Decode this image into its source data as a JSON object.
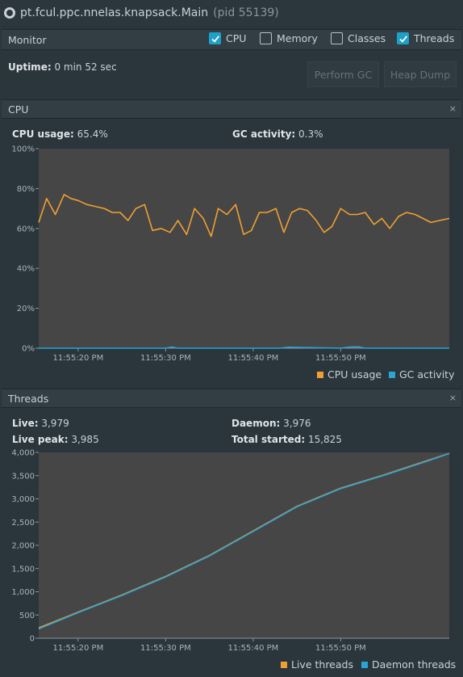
{
  "window": {
    "process_name": "pt.fcul.ppc.nnelas.knapsack.Main",
    "pid_label": "(pid 55139)"
  },
  "monitor": {
    "label": "Monitor",
    "checks": [
      {
        "label": "CPU",
        "checked": true
      },
      {
        "label": "Memory",
        "checked": false
      },
      {
        "label": "Classes",
        "checked": false
      },
      {
        "label": "Threads",
        "checked": true
      }
    ],
    "uptime_label": "Uptime:",
    "uptime_value": "0 min 52 sec",
    "perform_gc": "Perform GC",
    "heap_dump": "Heap Dump"
  },
  "cpu_section": {
    "title": "CPU",
    "usage_label": "CPU usage:",
    "usage_value": "65.4%",
    "gc_label": "GC activity:",
    "gc_value": "0.3%"
  },
  "threads_section": {
    "title": "Threads",
    "live_label": "Live:",
    "live_value": "3,979",
    "peak_label": "Live peak:",
    "peak_value": "3,985",
    "daemon_label": "Daemon:",
    "daemon_value": "3,976",
    "started_label": "Total started:",
    "started_value": "15,825"
  },
  "colors": {
    "orange": "#f0a030",
    "blue": "#2aa3d6"
  },
  "chart_data": [
    {
      "type": "line",
      "name": "cpu",
      "y_ticks": [
        "100%",
        "80%",
        "60%",
        "40%",
        "20%",
        "0%"
      ],
      "ylim": [
        0,
        100
      ],
      "x_ticks": [
        "11:55:20 PM",
        "11:55:30 PM",
        "11:55:40 PM",
        "11:55:50 PM"
      ],
      "x_tick_seconds": [
        20,
        30,
        40,
        50
      ],
      "xlim_seconds": [
        15.5,
        62.4
      ],
      "series": [
        {
          "name": "CPU usage",
          "color": "#f0a030",
          "x": [
            15.5,
            16.4,
            17.4,
            18.4,
            19.2,
            20.0,
            21.0,
            22.0,
            23.0,
            23.9,
            24.8,
            25.7,
            26.6,
            27.6,
            28.5,
            29.5,
            30.5,
            31.4,
            32.4,
            33.3,
            34.3,
            35.2,
            36.0,
            37.0,
            38.0,
            38.9,
            39.8,
            40.7,
            41.6,
            42.6,
            43.5,
            44.4,
            45.3,
            46.2,
            47.2,
            48.1,
            49.0,
            50.0,
            51.0,
            51.9,
            52.8,
            53.8,
            54.7,
            55.6,
            56.6,
            57.5,
            58.5,
            59.4,
            60.3,
            61.3,
            62.4
          ],
          "values": [
            63,
            75,
            67,
            77,
            75,
            74,
            72,
            71,
            70,
            68,
            68,
            64,
            70,
            72,
            59,
            60,
            58,
            64,
            57,
            70,
            65,
            56,
            70,
            67,
            72,
            57,
            59,
            68,
            68,
            70,
            58,
            68,
            70,
            69,
            64,
            58,
            61,
            70,
            67,
            67,
            68,
            62,
            65,
            60,
            66,
            68,
            67,
            65,
            63,
            64,
            65
          ]
        },
        {
          "name": "GC activity",
          "color": "#2aa3d6",
          "x": [
            15.5,
            30.0,
            30.7,
            31.4,
            40.0,
            43.0,
            44.0,
            50.0,
            51.0,
            52.0,
            52.8,
            62.4
          ],
          "values": [
            0,
            0,
            0.6,
            0,
            0,
            0,
            0.5,
            0,
            0.6,
            0.7,
            0,
            0
          ]
        }
      ],
      "legend": [
        "CPU usage",
        "GC activity"
      ]
    },
    {
      "type": "line",
      "name": "threads",
      "y_ticks": [
        "4,000",
        "3,500",
        "3,000",
        "2,500",
        "2,000",
        "1,500",
        "1,000",
        "500",
        "0"
      ],
      "ylim": [
        0,
        4000
      ],
      "x_ticks": [
        "11:55:20 PM",
        "11:55:30 PM",
        "11:55:40 PM",
        "11:55:50 PM"
      ],
      "x_tick_seconds": [
        20,
        30,
        40,
        50
      ],
      "xlim_seconds": [
        15.5,
        62.4
      ],
      "series": [
        {
          "name": "Live threads",
          "color": "#f0a030",
          "x": [
            15.5,
            20,
            25,
            30,
            35,
            40,
            45,
            50,
            55,
            60,
            62.4
          ],
          "values": [
            220,
            560,
            930,
            1330,
            1780,
            2310,
            2840,
            3230,
            3520,
            3830,
            3979
          ]
        },
        {
          "name": "Daemon threads",
          "color": "#2aa3d6",
          "x": [
            15.5,
            20,
            25,
            30,
            35,
            40,
            45,
            50,
            55,
            60,
            62.4
          ],
          "values": [
            200,
            550,
            920,
            1320,
            1770,
            2300,
            2830,
            3220,
            3510,
            3820,
            3976
          ]
        }
      ],
      "legend": [
        "Live threads",
        "Daemon threads"
      ]
    }
  ]
}
